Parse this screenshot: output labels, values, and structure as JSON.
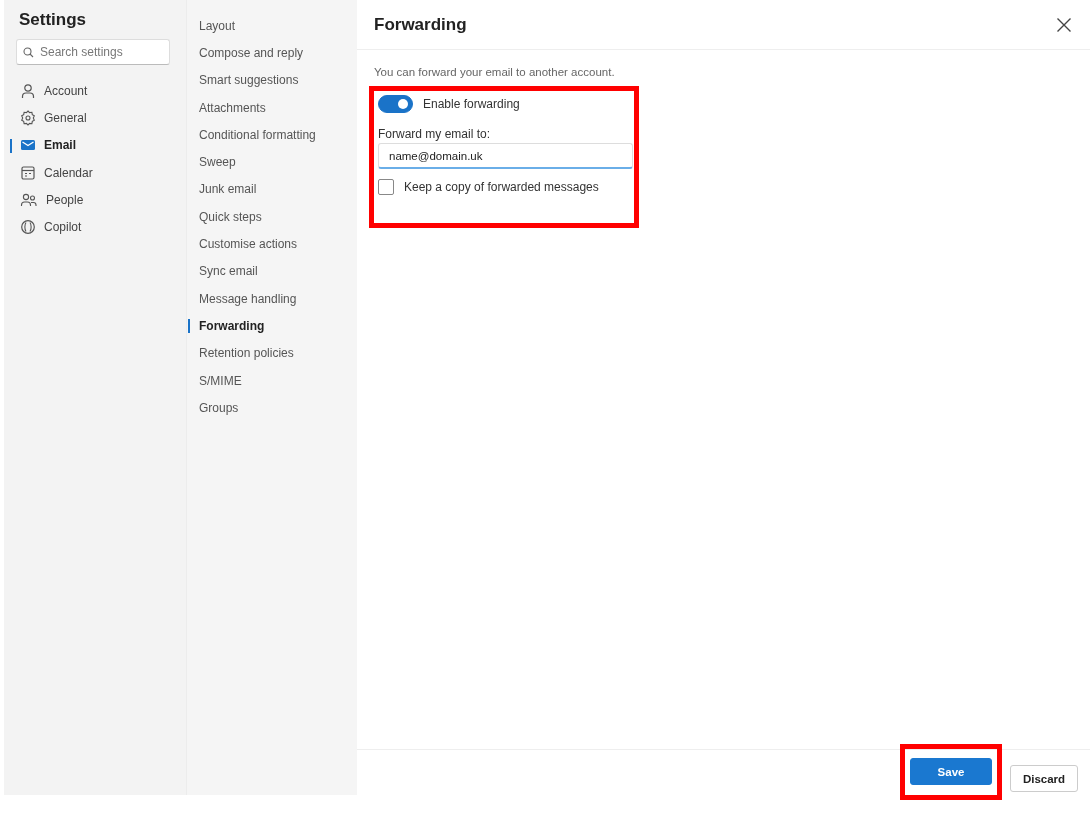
{
  "sidebar": {
    "title": "Settings",
    "search": {
      "placeholder": "Search settings"
    },
    "items": [
      {
        "label": "Account",
        "selected": false
      },
      {
        "label": "General",
        "selected": false
      },
      {
        "label": "Email",
        "selected": true
      },
      {
        "label": "Calendar",
        "selected": false
      },
      {
        "label": "People",
        "selected": false
      },
      {
        "label": "Copilot",
        "selected": false
      }
    ]
  },
  "subnav": {
    "items": [
      {
        "label": "Layout",
        "selected": false
      },
      {
        "label": "Compose and reply",
        "selected": false
      },
      {
        "label": "Smart suggestions",
        "selected": false
      },
      {
        "label": "Attachments",
        "selected": false
      },
      {
        "label": "Conditional formatting",
        "selected": false
      },
      {
        "label": "Sweep",
        "selected": false
      },
      {
        "label": "Junk email",
        "selected": false
      },
      {
        "label": "Quick steps",
        "selected": false
      },
      {
        "label": "Customise actions",
        "selected": false
      },
      {
        "label": "Sync email",
        "selected": false
      },
      {
        "label": "Message handling",
        "selected": false
      },
      {
        "label": "Forwarding",
        "selected": true
      },
      {
        "label": "Retention policies",
        "selected": false
      },
      {
        "label": "S/MIME",
        "selected": false
      },
      {
        "label": "Groups",
        "selected": false
      }
    ]
  },
  "pane": {
    "title": "Forwarding",
    "description": "You can forward your email to another account.",
    "options": {
      "highlighted": true,
      "toggle": {
        "label": "Enable forwarding",
        "on": true
      },
      "address": {
        "label": "Forward my email to:",
        "value": "name@domain.uk"
      },
      "keep_copy": {
        "label": "Keep a copy of forwarded messages",
        "checked": false
      }
    },
    "buttons": [
      {
        "label": "Save",
        "kind": "primary",
        "highlighted": true
      },
      {
        "label": "Discard",
        "kind": "secondary",
        "highlighted": false
      }
    ]
  }
}
